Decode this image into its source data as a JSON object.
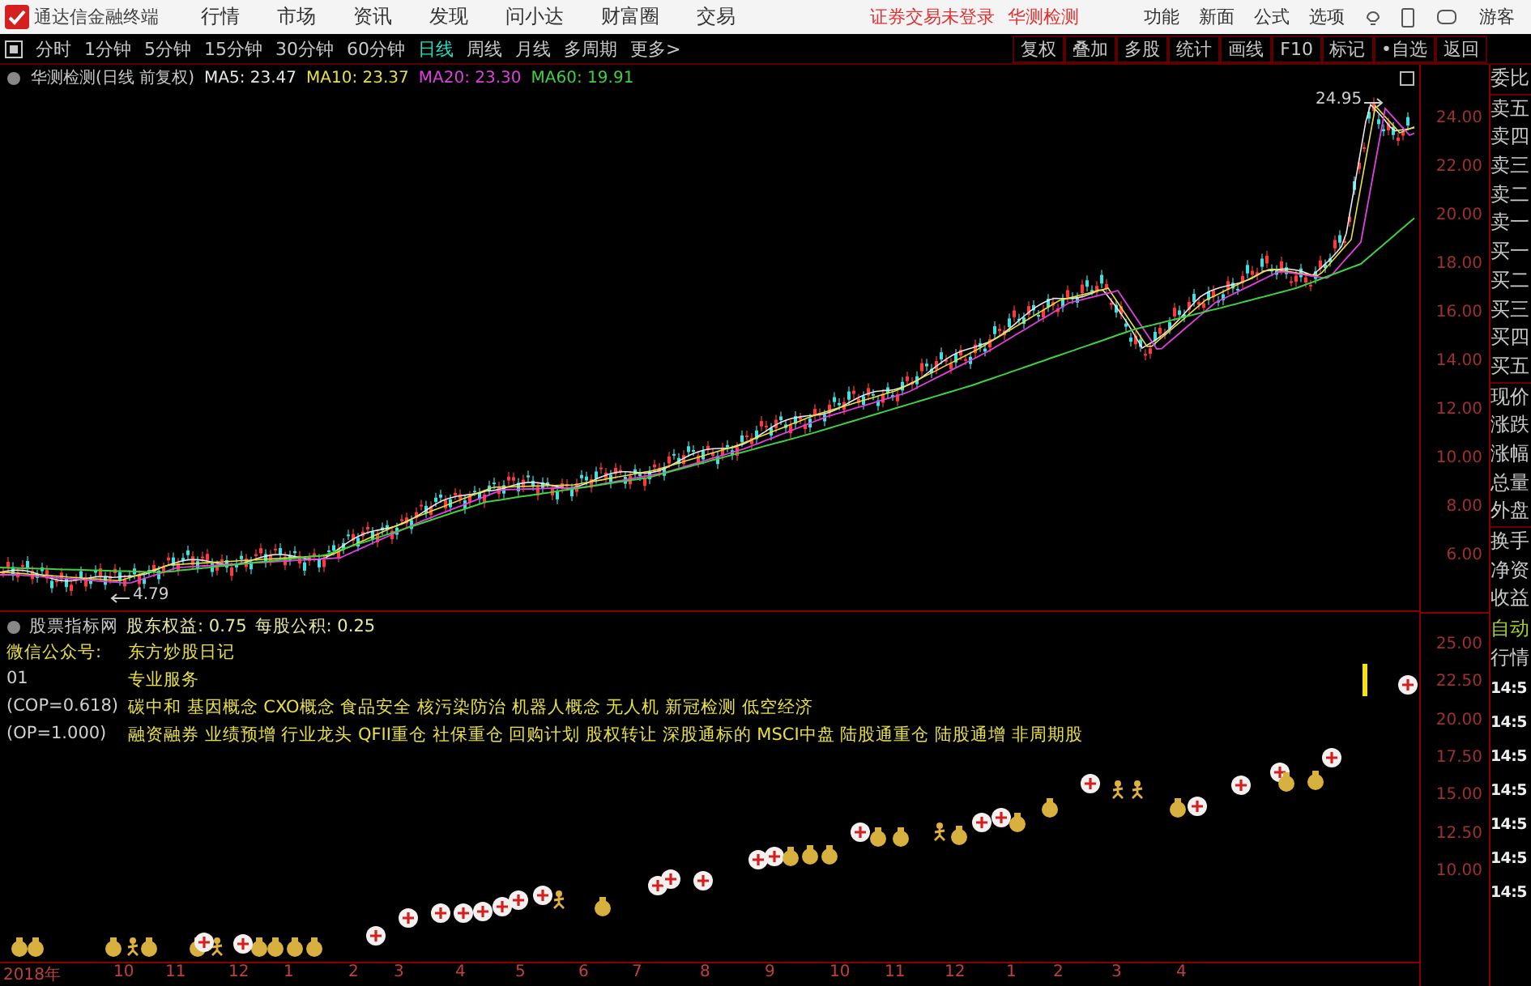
{
  "app": {
    "title": "通达信金融终端"
  },
  "menu": [
    "行情",
    "市场",
    "资讯",
    "发现",
    "问小达",
    "财富圈",
    "交易"
  ],
  "login_status": "证券交易未登录",
  "top_stock": "华测检测",
  "top_actions": [
    "功能",
    "新面",
    "公式",
    "选项"
  ],
  "user": "游客",
  "periods": [
    {
      "label": "分时",
      "selected": false
    },
    {
      "label": "1分钟",
      "selected": false
    },
    {
      "label": "5分钟",
      "selected": false
    },
    {
      "label": "15分钟",
      "selected": false
    },
    {
      "label": "30分钟",
      "selected": false
    },
    {
      "label": "60分钟",
      "selected": false
    },
    {
      "label": "日线",
      "selected": true
    },
    {
      "label": "周线",
      "selected": false
    },
    {
      "label": "月线",
      "selected": false
    },
    {
      "label": "多周期",
      "selected": false
    },
    {
      "label": "更多>",
      "selected": false
    }
  ],
  "tools": [
    "复权",
    "叠加",
    "多股",
    "统计",
    "画线",
    "F10",
    "标记",
    "•自选",
    "返回"
  ],
  "chart": {
    "legend_title": "华测检测(日线 前复权)",
    "ma": [
      {
        "name": "MA5:",
        "value": "23.47",
        "color": "#e8e8e8"
      },
      {
        "name": "MA10:",
        "value": "23.37",
        "color": "#e8e040"
      },
      {
        "name": "MA20:",
        "value": "23.30",
        "color": "#e040e0"
      },
      {
        "name": "MA60:",
        "value": "19.91",
        "color": "#40d040"
      }
    ],
    "high_label": "24.95",
    "low_label": "4.79",
    "price_ticks": [
      "24.00",
      "22.00",
      "20.00",
      "18.00",
      "16.00",
      "14.00",
      "12.00",
      "10.00",
      "8.00",
      "6.00"
    ]
  },
  "indicator": {
    "title": "股票指标网",
    "fields": [
      {
        "label": "股东权益:",
        "value": "0.75"
      },
      {
        "label": "每股公积:",
        "value": "0.25"
      }
    ],
    "lines": [
      {
        "key": "微信公众号:",
        "text": "东方炒股日记"
      },
      {
        "key": "01",
        "text": "专业服务"
      },
      {
        "key": "(COP=0.618)",
        "text": "碳中和 基因概念 CXO概念 食品安全 核污染防治 机器人概念 无人机 新冠检测 低空经济"
      },
      {
        "key": "(OP=1.000)",
        "text": "融资融券 业绩预增 行业龙头 QFII重仓 社保重仓 回购计划 股权转让 深股通标的 MSCI中盘 陆股通重仓 陆股通增 非周期股"
      }
    ],
    "ticks": [
      "25.00",
      "22.50",
      "20.00",
      "17.50",
      "15.00",
      "12.50",
      "10.00"
    ]
  },
  "x_axis": [
    "2018年",
    "10",
    "11",
    "12",
    "1",
    "2",
    "3",
    "4",
    "5",
    "6",
    "7",
    "8",
    "9",
    "10",
    "11",
    "12",
    "1",
    "2",
    "3",
    "4"
  ],
  "quote_labels": [
    "委比",
    "卖五",
    "卖四",
    "卖三",
    "卖二",
    "卖一",
    "买一",
    "买二",
    "买三",
    "买四",
    "买五",
    "现价",
    "涨跌",
    "涨幅",
    "总量",
    "外盘",
    "换手",
    "净资",
    "收益"
  ],
  "auto_labels": [
    "自动",
    "行情"
  ],
  "times": [
    "14:5",
    "14:5",
    "14:5",
    "14:5",
    "14:5",
    "14:5",
    "14:5"
  ]
}
